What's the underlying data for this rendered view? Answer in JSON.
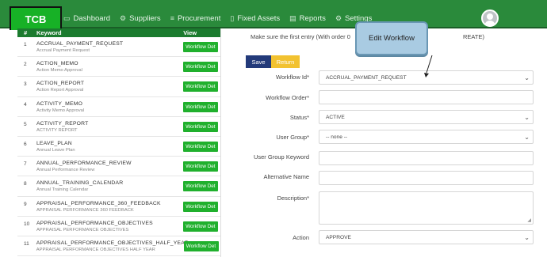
{
  "app": {
    "logo": "TCB"
  },
  "nav": [
    {
      "icon": "dashboard-icon",
      "glyph": "▭",
      "label": "Dashboard"
    },
    {
      "icon": "suppliers-icon",
      "glyph": "⚙",
      "label": "Suppliers"
    },
    {
      "icon": "procurement-icon",
      "glyph": "≡",
      "label": "Procurement"
    },
    {
      "icon": "fixed-assets-icon",
      "glyph": "▯",
      "label": "Fixed Assets"
    },
    {
      "icon": "reports-icon",
      "glyph": "▤",
      "label": "Reports"
    },
    {
      "icon": "settings-icon",
      "glyph": "⚙",
      "label": "Settings"
    }
  ],
  "table": {
    "headers": {
      "num": "#",
      "keyword": "Keyword",
      "view": "View"
    },
    "button_label": "Workflow Det",
    "rows": [
      {
        "num": "1",
        "keyword": "ACCRUAL_PAYMENT_REQUEST",
        "sub": "Accrual Payment Request"
      },
      {
        "num": "2",
        "keyword": "ACTION_MEMO",
        "sub": "Action Memo Approval"
      },
      {
        "num": "3",
        "keyword": "ACTION_REPORT",
        "sub": "Action Report Approval"
      },
      {
        "num": "4",
        "keyword": "ACTIVITY_MEMO",
        "sub": "Activity Memo Approval"
      },
      {
        "num": "5",
        "keyword": "ACTIVITY_REPORT",
        "sub": "ACTIVITY REPORT"
      },
      {
        "num": "6",
        "keyword": "LEAVE_PLAN",
        "sub": "Annual Leave Plan"
      },
      {
        "num": "7",
        "keyword": "ANNUAL_PERFORMANCE_REVIEW",
        "sub": "Annual Performance Review"
      },
      {
        "num": "8",
        "keyword": "ANNUAL_TRAINING_CALENDAR",
        "sub": "Annual Training Calendar"
      },
      {
        "num": "9",
        "keyword": "APPRAISAL_PERFORMANCE_360_FEEDBACK",
        "sub": "APPRAISAL PERFORMANCE 360 FEEDBACK"
      },
      {
        "num": "10",
        "keyword": "APPRAISAL_PERFORMANCE_OBJECTIVES",
        "sub": "APPRAISAL PERFORMANCE OBJECTIVES"
      },
      {
        "num": "11",
        "keyword": "APPRAISAL_PERFORMANCE_OBJECTIVES_HALF_YEAR",
        "sub": "APPRAISAL PERFORMANCE OBJECTIVES HALF YEAR"
      }
    ]
  },
  "form": {
    "note": "Make sure the first entry (With order 0",
    "note_tail": "REATE)",
    "save_label": "Save",
    "return_label": "Return",
    "fields": {
      "workflow_id": {
        "label": "Workflow Id*",
        "value": "ACCRUAL_PAYMENT_REQUEST"
      },
      "workflow_order": {
        "label": "Workflow Order*",
        "value": ""
      },
      "status": {
        "label": "Status*",
        "value": "ACTIVE"
      },
      "user_group": {
        "label": "User Group*",
        "value": "-- none --"
      },
      "user_group_keyword": {
        "label": "User Group Keyword",
        "value": ""
      },
      "alternative_name": {
        "label": "Alternative Name",
        "value": ""
      },
      "description": {
        "label": "Description*",
        "value": ""
      },
      "action": {
        "label": "Action",
        "value": "APPROVE"
      }
    }
  },
  "callout": {
    "text": "Edit Workflow"
  },
  "colors": {
    "topbar": "#2a8a3b",
    "logo": "#17b126",
    "table_header": "#1b7b2e",
    "workflow_button": "#20b02d",
    "save": "#233a7a",
    "return": "#f2c230",
    "callout": "#a9cbe2"
  }
}
